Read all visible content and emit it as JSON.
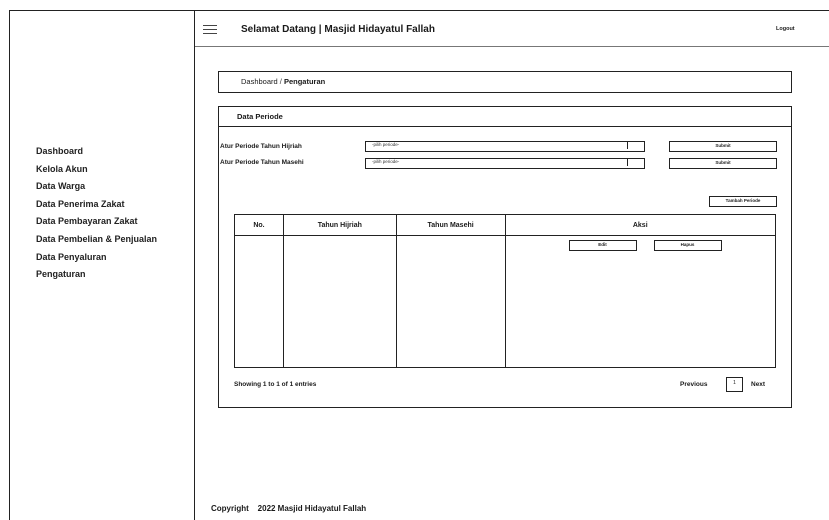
{
  "header": {
    "title": "Selamat Datang | Masjid Hidayatul Fallah",
    "logout_label": "Logout"
  },
  "sidebar": {
    "items": [
      {
        "label": "Dashboard"
      },
      {
        "label": "Kelola Akun"
      },
      {
        "label": "Data Warga"
      },
      {
        "label": "Data Penerima Zakat"
      },
      {
        "label": "Data Pembayaran Zakat"
      },
      {
        "label": "Data Pembelian & Penjualan"
      },
      {
        "label": "Data Penyaluran"
      },
      {
        "label": "Pengaturan"
      }
    ]
  },
  "breadcrumb": {
    "parent": "Dashboard",
    "separator": " / ",
    "current": "Pengaturan"
  },
  "card": {
    "title": "Data Periode",
    "form": {
      "hijriah_label": "Atur Periode Tahun  Hijriah",
      "masehi_label": "Atur Periode Tahun  Masehi",
      "select_placeholder": "-pilih periode-",
      "submit_label": "Submit"
    },
    "add_button": "Tambah Periode",
    "table": {
      "headers": [
        "No.",
        "Tahun Hijriah",
        "Tahun Masehi",
        "Aksi"
      ],
      "edit_label": "Edit",
      "delete_label": "Hapus"
    },
    "pagination": {
      "info": "Showing 1 to 1 of 1 entries",
      "previous": "Previous",
      "page": "1",
      "next": "Next"
    }
  },
  "footer": {
    "text": "Copyright    2022 Masjid Hidayatul Fallah"
  }
}
